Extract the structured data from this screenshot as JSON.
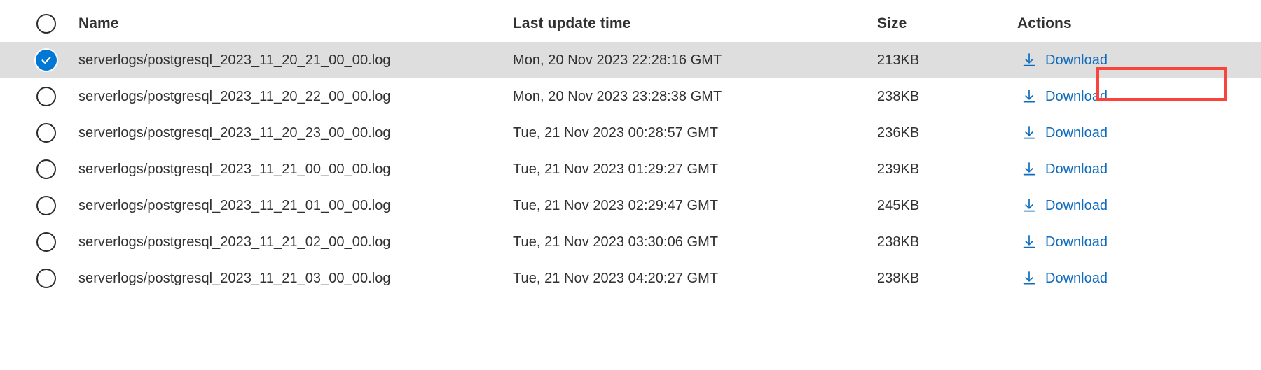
{
  "table": {
    "columns": {
      "select_all": "",
      "name": "Name",
      "last_update_time": "Last update time",
      "size": "Size",
      "actions": "Actions"
    },
    "action_label": "Download",
    "accent_color": "#0f6cbd",
    "selected_color": "#0078d4",
    "selected_row_background": "#dedede",
    "highlight_color": "#f8443c",
    "rows": [
      {
        "name": "serverlogs/postgresql_2023_11_20_21_00_00.log",
        "last_update_time": "Mon, 20 Nov 2023 22:28:16 GMT",
        "size": "213KB",
        "action": "Download",
        "selected": true
      },
      {
        "name": "serverlogs/postgresql_2023_11_20_22_00_00.log",
        "last_update_time": "Mon, 20 Nov 2023 23:28:38 GMT",
        "size": "238KB",
        "action": "Download",
        "selected": false
      },
      {
        "name": "serverlogs/postgresql_2023_11_20_23_00_00.log",
        "last_update_time": "Tue, 21 Nov 2023 00:28:57 GMT",
        "size": "236KB",
        "action": "Download",
        "selected": false
      },
      {
        "name": "serverlogs/postgresql_2023_11_21_00_00_00.log",
        "last_update_time": "Tue, 21 Nov 2023 01:29:27 GMT",
        "size": "239KB",
        "action": "Download",
        "selected": false
      },
      {
        "name": "serverlogs/postgresql_2023_11_21_01_00_00.log",
        "last_update_time": "Tue, 21 Nov 2023 02:29:47 GMT",
        "size": "245KB",
        "action": "Download",
        "selected": false
      },
      {
        "name": "serverlogs/postgresql_2023_11_21_02_00_00.log",
        "last_update_time": "Tue, 21 Nov 2023 03:30:06 GMT",
        "size": "238KB",
        "action": "Download",
        "selected": false
      },
      {
        "name": "serverlogs/postgresql_2023_11_21_03_00_00.log",
        "last_update_time": "Tue, 21 Nov 2023 04:20:27 GMT",
        "size": "238KB",
        "action": "Download",
        "selected": false
      }
    ]
  }
}
